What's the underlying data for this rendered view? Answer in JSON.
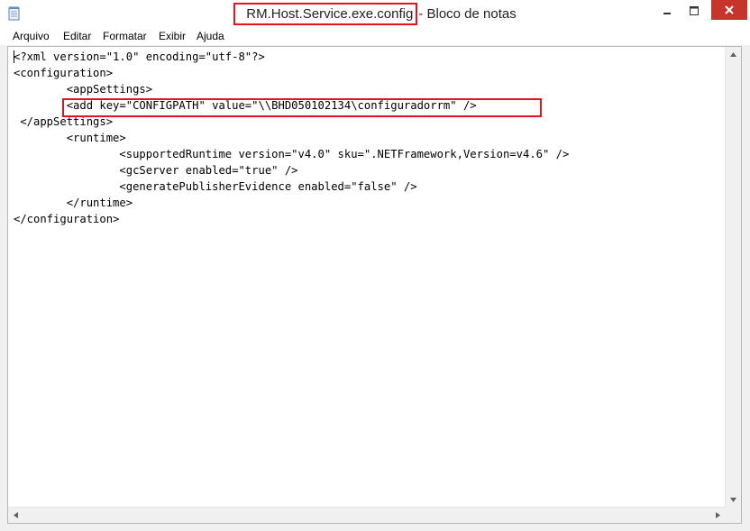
{
  "window": {
    "title_file": "RM.Host.Service.exe.config",
    "title_suffix": " - Bloco de notas"
  },
  "menu": {
    "items": [
      {
        "label": "Arquivo"
      },
      {
        "label": "Editar"
      },
      {
        "label": "Formatar"
      },
      {
        "label": "Exibir"
      },
      {
        "label": "Ajuda"
      }
    ]
  },
  "editor": {
    "lines": [
      "<?xml version=\"1.0\" encoding=\"utf-8\"?>",
      "<configuration>",
      "        <appSettings>",
      "        <add key=\"CONFIGPATH\" value=\"\\\\BHD050102134\\configuradorrm\" />",
      " </appSettings>",
      "        <runtime>",
      "                <supportedRuntime version=\"v4.0\" sku=\".NETFramework,Version=v4.6\" />",
      "                <gcServer enabled=\"true\" />",
      "                <generatePublisherEvidence enabled=\"false\" />",
      "        </runtime>",
      "</configuration>"
    ]
  },
  "colors": {
    "highlight": "#e3141f",
    "close_button": "#c7342c"
  }
}
